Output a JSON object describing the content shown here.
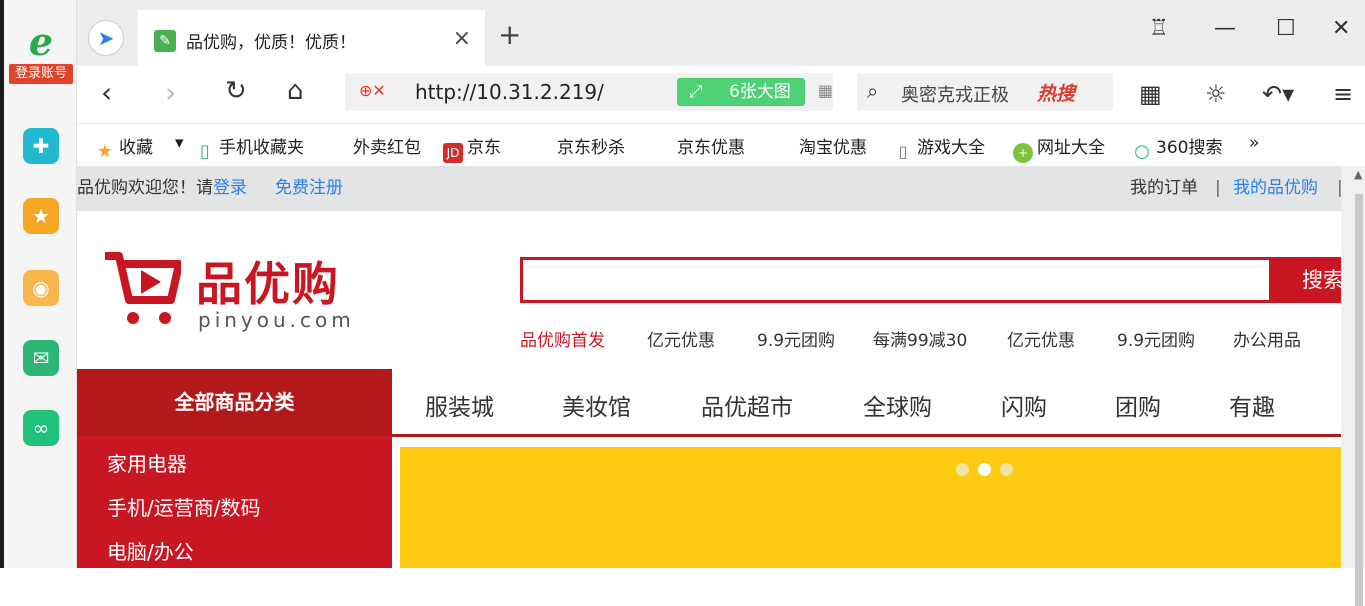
{
  "left_rail": {
    "login_label": "登录账号"
  },
  "tab": {
    "title": "品优购，优质！优质！"
  },
  "toolbar": {
    "url": "http://10.31.2.219/",
    "big_image_label": "6张大图",
    "search_text": "奥密克戎正极",
    "hot_label": "热搜"
  },
  "bookmarks": [
    "收藏",
    "手机收藏夹",
    "外卖红包",
    "京东",
    "京东秒杀",
    "京东优惠",
    "淘宝优惠",
    "游戏大全",
    "网址大全",
    "360搜索",
    "»"
  ],
  "shortcut": {
    "welcome": "品优购欢迎您！请",
    "login": "登录",
    "register": "免费注册",
    "orders": "我的订单",
    "my_account": "我的品优购"
  },
  "logo": {
    "name": "品优购",
    "domain": "pinyou.com"
  },
  "search": {
    "button": "搜索"
  },
  "hotwords": [
    "品优购首发",
    "亿元优惠",
    "9.9元团购",
    "每满99减30",
    "亿元优惠",
    "9.9元团购",
    "办公用品"
  ],
  "category_title": "全部商品分类",
  "nav": [
    "服装城",
    "美妆馆",
    "品优超市",
    "全球购",
    "闪购",
    "团购",
    "有趣"
  ],
  "categories": [
    "家用电器",
    "手机/运营商/数码",
    "电脑/办公"
  ],
  "colors": {
    "brand_red": "#c81623",
    "category_red": "#b1191a",
    "banner_yellow": "#fdcb12",
    "link_blue": "#2a7fe8"
  }
}
